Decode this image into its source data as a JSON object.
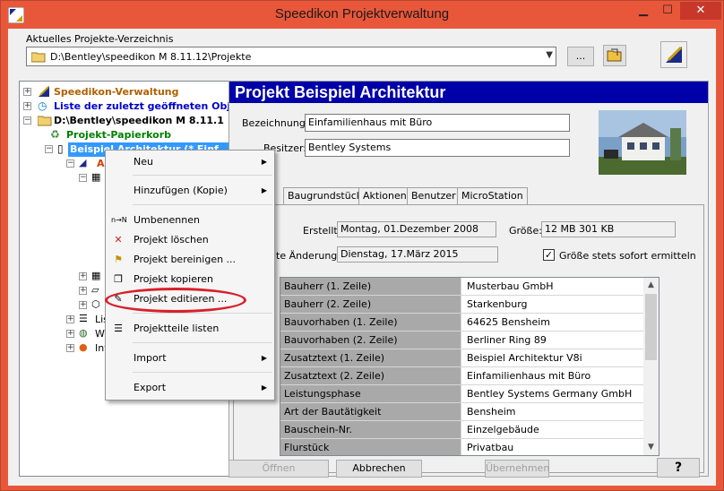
{
  "window": {
    "title": "Speedikon Projektverwaltung"
  },
  "colors": {
    "titlebar": "#e9573a",
    "project_header": "#0000a8",
    "highlight_ellipse": "#d8202a",
    "tree_selection": "#3399ff"
  },
  "directory": {
    "label": "Aktuelles Projekte-Verzeichnis",
    "value": "D:\\Bentley\\speedikon M 8.11.12\\Projekte",
    "browse_label": "..."
  },
  "tree": {
    "items": [
      {
        "label": "Speedikon-Verwaltung",
        "color": "#b06000",
        "icon": "pencil-triangle-icon"
      },
      {
        "label": "Liste der zuletzt geöffneten Obj",
        "color": "#0000cc",
        "icon": "recent-list-icon"
      },
      {
        "label": "D:\\Bentley\\speedikon M 8.11.1",
        "color": "#000000",
        "icon": "folder-icon"
      },
      {
        "label": "Projekt-Papierkorb",
        "color": "#008000",
        "icon": "recycle-bin-icon"
      },
      {
        "label": "Beispiel Architektur   (* Einf",
        "color": "#ffffff",
        "icon": "project-icon"
      },
      {
        "label": "Ar",
        "color": "#d04000",
        "icon": "arch-icon"
      },
      {
        "label": "Lis",
        "color": "#000000",
        "icon": "list-icon"
      },
      {
        "label": "W",
        "color": "#000000",
        "icon": "web-icon"
      },
      {
        "label": "Int",
        "color": "#000000",
        "icon": "firefox-icon"
      }
    ]
  },
  "project": {
    "header": "Projekt  Beispiel Architektur",
    "bezeichnung_label": "Bezeichnung:",
    "bezeichnung_value": "Einfamilienhaus mit Büro",
    "besitzer_label": "Besitzer:",
    "besitzer_value": "Bentley Systems",
    "tabs": [
      "Baugrundstück",
      "Aktionen",
      "Benutzer",
      "MicroStation"
    ],
    "erstellt_label": "Erstellt:",
    "erstellt_value": "Montag, 01.Dezember 2008",
    "groesse_label": "Größe:",
    "groesse_value": "12 MB 301 KB",
    "aenderung_label": "te Änderung:",
    "aenderung_value": "Dienstag, 17.März 2015",
    "checkbox_label": "Größe stets sofort ermitteln",
    "checkbox_checked": true,
    "rows": [
      {
        "key": "Bauherr   (1. Zeile)",
        "value": "Musterbau GmbH"
      },
      {
        "key": "Bauherr   (2. Zeile)",
        "value": "Starkenburg"
      },
      {
        "key": "Bauvorhaben (1. Zeile)",
        "value": "64625 Bensheim"
      },
      {
        "key": "Bauvorhaben (2. Zeile)",
        "value": "Berliner Ring 89"
      },
      {
        "key": "Zusatztext (1. Zeile)",
        "value": "Beispiel Architektur V8i"
      },
      {
        "key": "Zusatztext (2. Zeile)",
        "value": "Einfamilienhaus mit Büro"
      },
      {
        "key": "Leistungsphase",
        "value": "Bentley Systems Germany GmbH"
      },
      {
        "key": "Art der Bautätigkeit",
        "value": "Bensheim"
      },
      {
        "key": "Bauschein-Nr.",
        "value": "Einzelgebäude"
      },
      {
        "key": "Flurstück",
        "value": "Privatbau"
      }
    ]
  },
  "context_menu": {
    "items": [
      {
        "label": "Neu",
        "submenu": true,
        "icon": ""
      },
      {
        "label": "Hinzufügen (Kopie)",
        "submenu": true,
        "icon": ""
      },
      {
        "label": "Umbenennen",
        "submenu": false,
        "icon": "rename-icon",
        "icon_text": "n→N"
      },
      {
        "label": "Projekt löschen",
        "submenu": false,
        "icon": "delete-x-icon",
        "icon_text": "✕"
      },
      {
        "label": "Projekt bereinigen ...",
        "submenu": false,
        "icon": "broom-icon",
        "icon_text": "⚑"
      },
      {
        "label": "Projekt kopieren",
        "submenu": false,
        "icon": "copy-icon",
        "icon_text": "❐"
      },
      {
        "label": "Projekt editieren ...",
        "submenu": false,
        "icon": "edit-icon",
        "icon_text": "✎"
      },
      {
        "label": "Projektteile listen",
        "submenu": false,
        "icon": "list-icon",
        "icon_text": "☰"
      },
      {
        "label": "Import",
        "submenu": true,
        "icon": ""
      },
      {
        "label": "Export",
        "submenu": true,
        "icon": ""
      }
    ]
  },
  "footer": {
    "open_label": "Öffnen",
    "cancel_label": "Abbrechen",
    "apply_label": "Übernehmen",
    "help_label": "?"
  }
}
